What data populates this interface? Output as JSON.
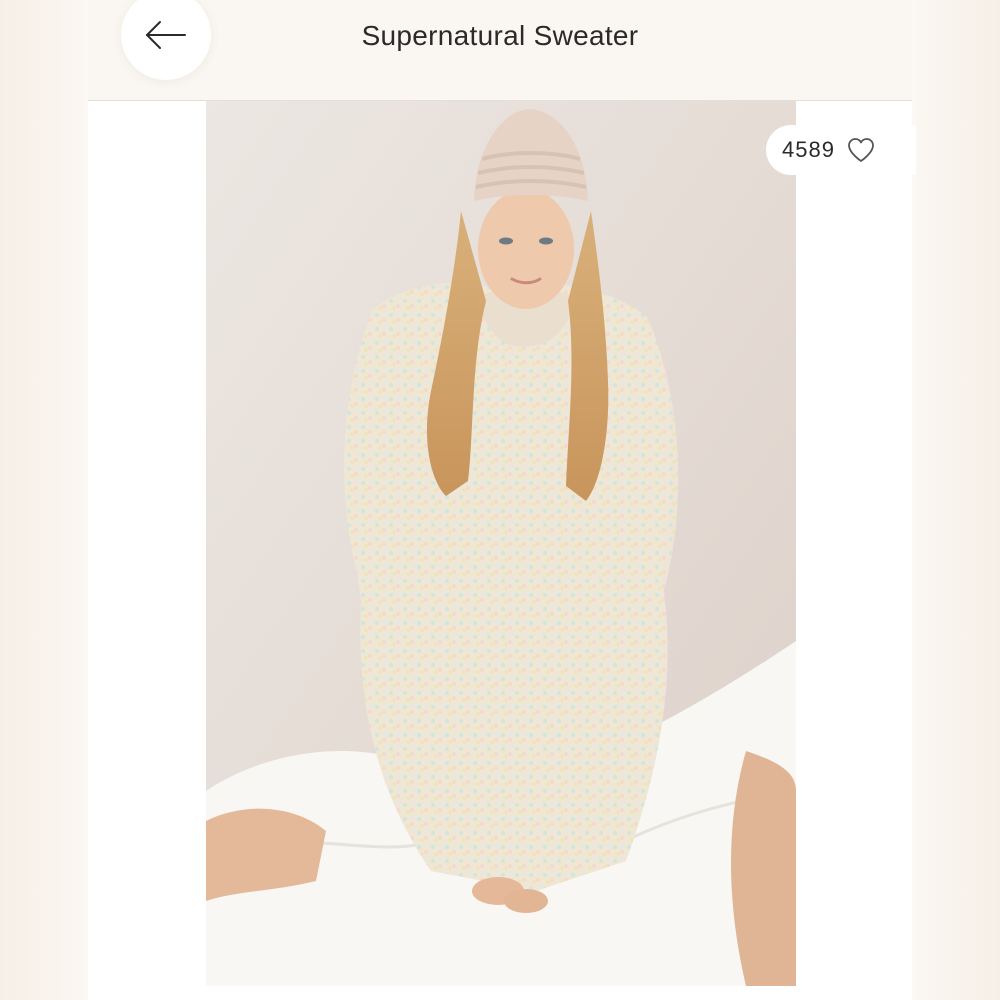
{
  "header": {
    "title": "Supernatural Sweater"
  },
  "listing": {
    "likes": "4589",
    "image_alt": "Model wearing a pastel speckled oversized chunky knit turtleneck sweater, knit beanie, and white ruffled skirt"
  },
  "icons": {
    "back": "arrow-left-icon",
    "like": "heart-outline-icon"
  },
  "colors": {
    "background": "#f7f1ea",
    "header": "#faf6f1",
    "text": "#2a2a2a"
  }
}
